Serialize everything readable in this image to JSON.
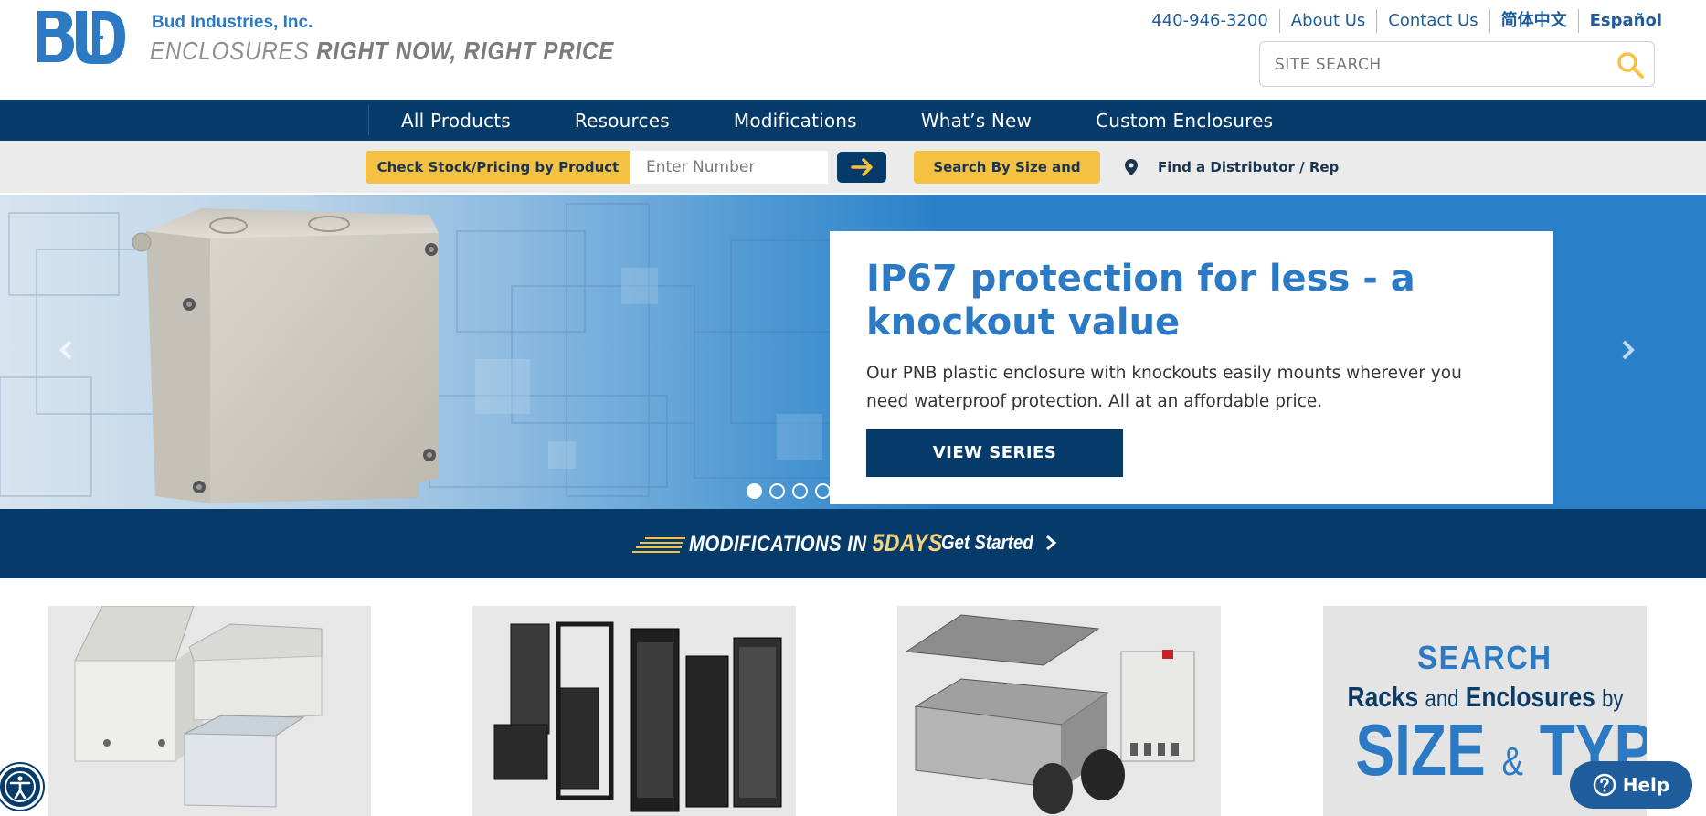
{
  "header": {
    "company_name": "Bud Industries, Inc.",
    "tagline_light": "ENCLOSURES",
    "tagline_bold": "RIGHT NOW, RIGHT PRICE",
    "logo_letters": "BUD",
    "logo_icon": "bud-logo-icon"
  },
  "toplinks": {
    "phone": "440-946-3200",
    "about": "About Us",
    "contact": "Contact Us",
    "chinese": "简体中文",
    "spanish": "Español"
  },
  "search": {
    "placeholder": "SITE SEARCH",
    "icon": "search-icon"
  },
  "nav": {
    "items": [
      "All Products",
      "Resources",
      "Modifications",
      "What’s New",
      "Custom Enclosures"
    ]
  },
  "stockbar": {
    "check_label": "Check Stock/Pricing by Product No.",
    "input_placeholder": "Enter Number",
    "go_icon": "arrow-right-icon",
    "size_type_label": "Search By Size and Type",
    "distributor_label": "Find a Distributor / Rep",
    "distributor_icon": "map-pin-icon"
  },
  "hero": {
    "title": "IP67 protection for less - a knockout value",
    "text": "Our PNB plastic enclosure with knockouts easily mounts wherever you need waterproof protection. All at an affordable price.",
    "button": "VIEW SERIES",
    "slide_count": 4,
    "active_slide": 1
  },
  "mod_banner": {
    "text": "MODIFICATIONS IN",
    "days": "5DAYS",
    "cta": "Get Started"
  },
  "tiles": {
    "search_word": "SEARCH",
    "racks_a": "Racks",
    "racks_and": "and",
    "racks_b": "Enclosures",
    "racks_by": "by",
    "size": "SIZE",
    "amp": "&",
    "type": "TYPE"
  },
  "floating": {
    "help": "Help",
    "accessibility_icon": "accessibility-icon"
  },
  "colors": {
    "navy": "#063a69",
    "brand_blue": "#2d7ac4",
    "accent_yellow": "#f5c142"
  }
}
